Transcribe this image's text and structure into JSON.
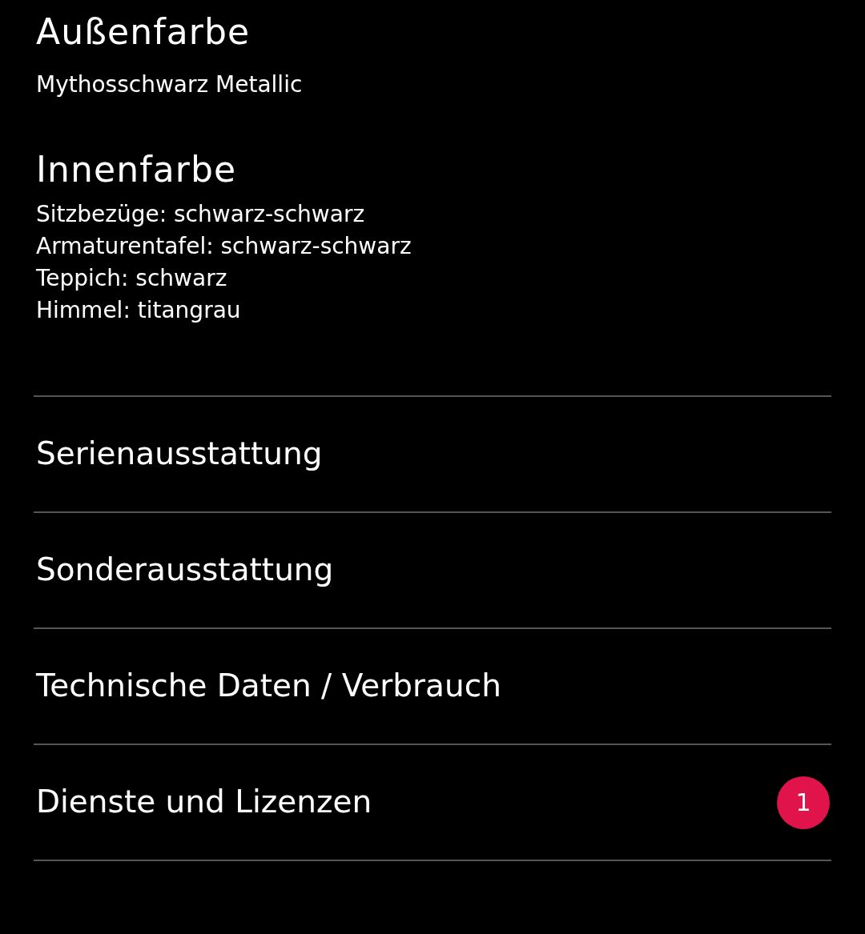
{
  "sections": [
    {
      "title": "Außenfarbe",
      "lines": [
        "Mythosschwarz Metallic"
      ]
    },
    {
      "title": "Innenfarbe",
      "lines": [
        "Sitzbezüge: schwarz-schwarz",
        "Armaturentafel: schwarz-schwarz",
        "Teppich: schwarz",
        "Himmel: titangrau"
      ]
    }
  ],
  "menu": [
    {
      "label": "Serienausstattung"
    },
    {
      "label": "Sonderausstattung"
    },
    {
      "label": "Technische Daten / Verbrauch"
    },
    {
      "label": "Dienste und Lizenzen",
      "badge": "1"
    }
  ]
}
